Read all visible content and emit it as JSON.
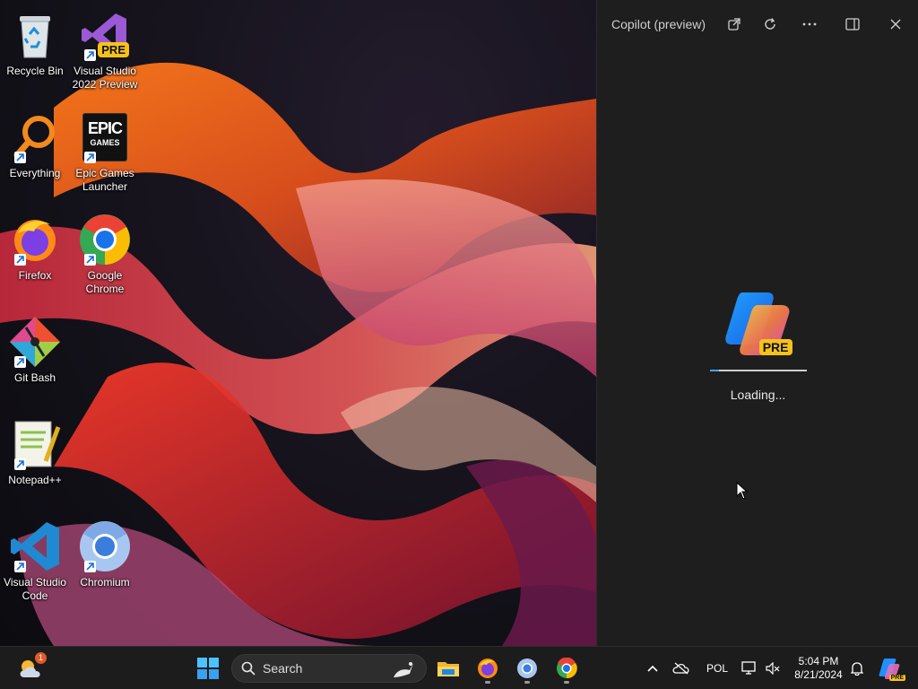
{
  "desktop": {
    "icons": [
      {
        "name": "recycle-bin",
        "label": "Recycle Bin"
      },
      {
        "name": "visual-studio-2022-preview",
        "label": "Visual Studio 2022 Preview",
        "badge": "PRE"
      },
      {
        "name": "everything",
        "label": "Everything"
      },
      {
        "name": "epic-games-launcher",
        "label": "Epic Games Launcher",
        "logo_top": "EPIC",
        "logo_bottom": "GAMES"
      },
      {
        "name": "firefox",
        "label": "Firefox"
      },
      {
        "name": "google-chrome",
        "label": "Google Chrome"
      },
      {
        "name": "git-bash",
        "label": "Git Bash"
      },
      {
        "name": "notepad-plus-plus",
        "label": "Notepad++"
      },
      {
        "name": "visual-studio-code",
        "label": "Visual Studio Code"
      },
      {
        "name": "chromium",
        "label": "Chromium"
      }
    ]
  },
  "copilot": {
    "title": "Copilot (preview)",
    "badge": "PRE",
    "loading_text": "Loading...",
    "progress": 0.1,
    "header_buttons": [
      "open-external-icon",
      "refresh-icon",
      "more-icon",
      "split-pane-icon",
      "close-icon"
    ]
  },
  "taskbar": {
    "search_label": "Search",
    "weather_badge": "1",
    "tray": {
      "language": "POL",
      "time": "5:04 PM",
      "date": "8/21/2024",
      "copilot_badge": "PRE"
    }
  },
  "colors": {
    "panel_bg": "#1e1e1e",
    "taskbar_bg": "#1c1c1c",
    "accent_blue": "#0078d4",
    "pre_badge": "#f6c21a"
  }
}
